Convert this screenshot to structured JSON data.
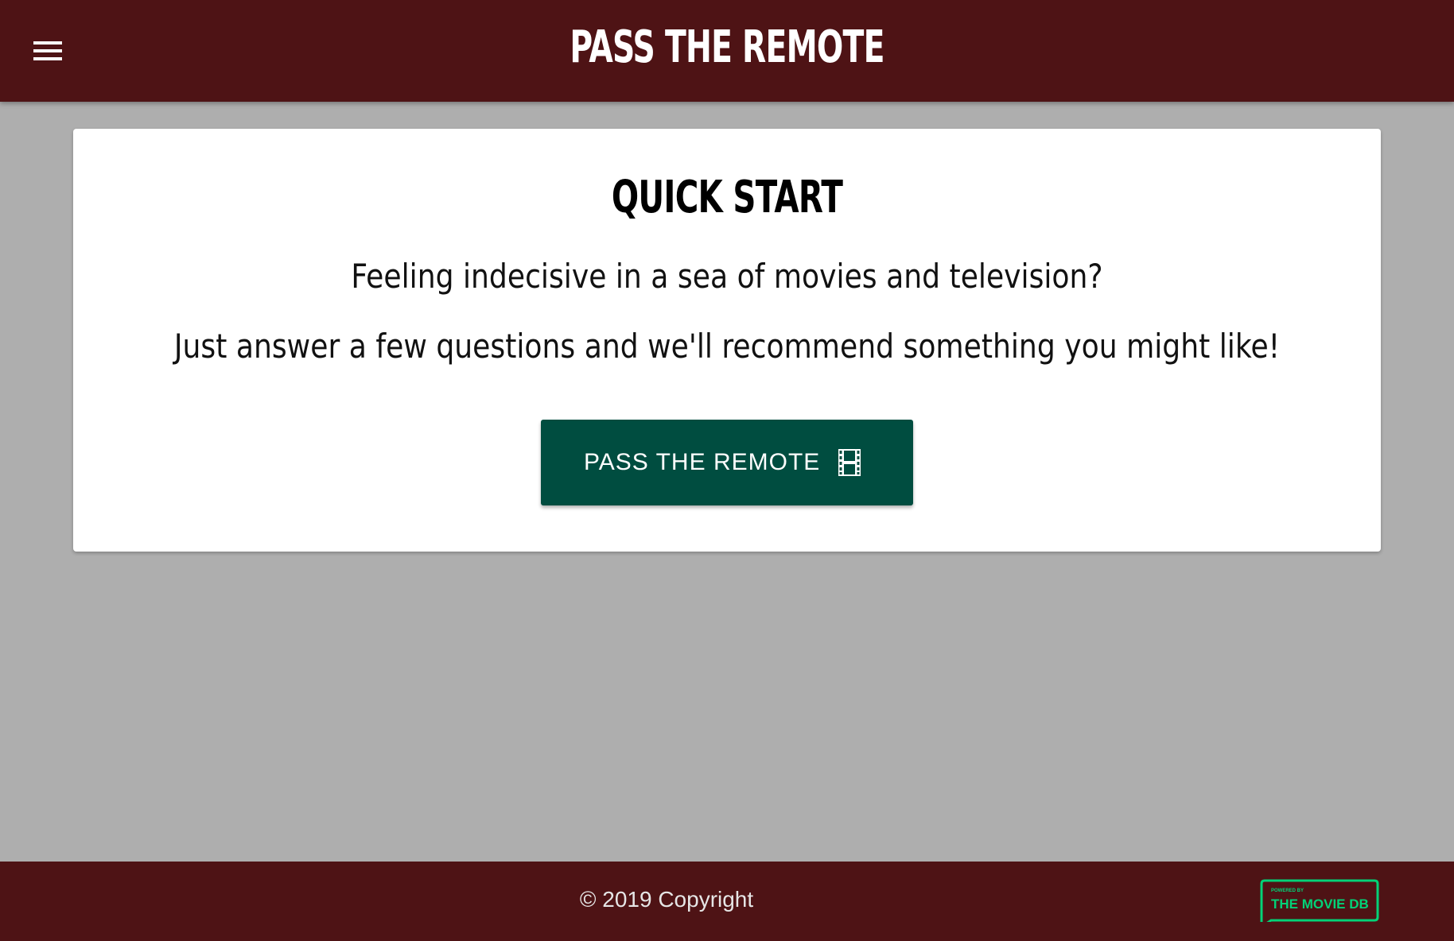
{
  "header": {
    "title": "PASS THE REMOTE",
    "menu_icon": "menu-icon"
  },
  "quick_start": {
    "title": "QUICK START",
    "line1": "Feeling indecisive in a sea of movies and television?",
    "line2": "Just answer a few questions and we'll recommend something you might like!",
    "button_label": "PASS THE REMOTE",
    "button_icon": "film-icon"
  },
  "footer": {
    "copyright": "© 2019 Copyright",
    "tmdb_logo_text_small": "POWERED BY",
    "tmdb_logo_text": "THE MOVIE DB"
  },
  "colors": {
    "header_bg": "#4e1315",
    "page_bg": "#aeaeae",
    "button_bg": "#004d40",
    "tmdb_green": "#01d277"
  }
}
